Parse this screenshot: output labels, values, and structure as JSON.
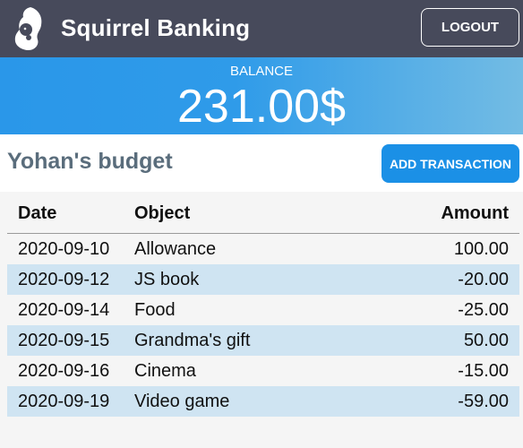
{
  "header": {
    "app_title": "Squirrel Banking",
    "logout_label": "LOGOUT",
    "logo_icon": "squirrel-logo-icon"
  },
  "balance": {
    "label": "BALANCE",
    "value": "231.00$"
  },
  "budget": {
    "title": "Yohan's budget",
    "add_label": "ADD TRANSACTION"
  },
  "table": {
    "headers": {
      "date": "Date",
      "object": "Object",
      "amount": "Amount"
    },
    "rows": [
      {
        "date": "2020-09-10",
        "object": "Allowance",
        "amount": "100.00"
      },
      {
        "date": "2020-09-12",
        "object": "JS book",
        "amount": "-20.00"
      },
      {
        "date": "2020-09-14",
        "object": "Food",
        "amount": "-25.00"
      },
      {
        "date": "2020-09-15",
        "object": "Grandma's gift",
        "amount": "50.00"
      },
      {
        "date": "2020-09-16",
        "object": "Cinema",
        "amount": "-15.00"
      },
      {
        "date": "2020-09-19",
        "object": "Video game",
        "amount": "-59.00"
      }
    ]
  },
  "colors": {
    "header_bg": "#474a5b",
    "balance_gradient_start": "#2a97e9",
    "balance_gradient_end": "#73bce4",
    "accent_button": "#1b90e6",
    "alt_row": "#cfe4f2"
  }
}
